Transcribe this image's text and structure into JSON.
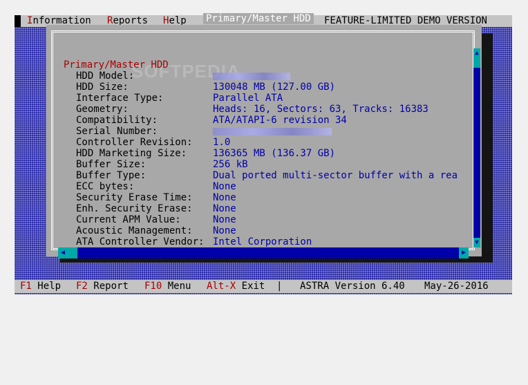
{
  "menu": {
    "items": [
      {
        "hot": "I",
        "rest": "nformation"
      },
      {
        "hot": "R",
        "rest": "eports"
      },
      {
        "hot": "H",
        "rest": "elp"
      }
    ],
    "banner": "FEATURE-LIMITED DEMO VERSION"
  },
  "window": {
    "title": "Primary/Master HDD",
    "section": "Primary/Master HDD"
  },
  "watermark": "SOFTPEDIA",
  "rows": [
    {
      "label": "HDD Model:",
      "value": ""
    },
    {
      "label": "HDD Size:",
      "value": "130048 MB (127.00 GB)"
    },
    {
      "label": "Interface Type:",
      "value": "Parallel ATA"
    },
    {
      "label": "Geometry:",
      "value": "Heads: 16, Sectors: 63, Tracks: 16383"
    },
    {
      "label": "Compatibility:",
      "value": "ATA/ATAPI-6 revision 34"
    },
    {
      "label": "Serial Number:",
      "value": ""
    },
    {
      "label": "Controller Revision:",
      "value": "1.0"
    },
    {
      "label": "HDD Marketing Size:",
      "value": "136365 MB (136.37 GB)"
    },
    {
      "label": "Buffer Size:",
      "value": "256 kB"
    },
    {
      "label": "Buffer Type:",
      "value": "Dual ported multi-sector buffer with a rea"
    },
    {
      "label": "ECC bytes:",
      "value": "None"
    },
    {
      "label": "Security Erase Time:",
      "value": "None"
    },
    {
      "label": "Enh. Security Erase:",
      "value": "None"
    },
    {
      "label": "Current APM Value:",
      "value": "None"
    },
    {
      "label": "Acoustic Management:",
      "value": "None"
    },
    {
      "label": "ATA Controller Vendor:",
      "value": "Intel Corporation"
    }
  ],
  "status": {
    "f1_key": "F1",
    "f1_label": "Help",
    "f2_key": "F2",
    "f2_label": "Report",
    "f10_key": "F10",
    "f10_label": "Menu",
    "altx_key": "Alt-X",
    "altx_label": "Exit",
    "separator": "|",
    "version": "ASTRA Version 6.40",
    "date": "May-26-2016"
  },
  "icons": {
    "scroll_up": "arrow-up-icon",
    "scroll_down": "arrow-down-icon",
    "scroll_left": "arrow-left-icon",
    "scroll_right": "arrow-right-icon"
  },
  "colors": {
    "desktop": "#2a2aa8",
    "menubar": "#c4c4c4",
    "hotkey": "#a80000",
    "window": "#a8a8a8",
    "value_text": "#0000a8",
    "scrollbar": "#00a8a8"
  }
}
